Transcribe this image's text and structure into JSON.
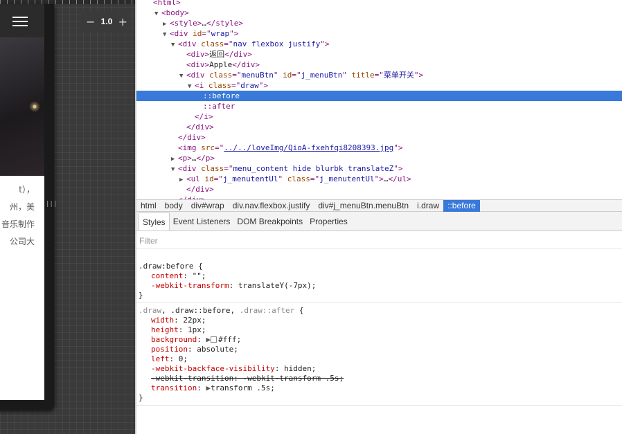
{
  "emulator": {
    "zoom_minus": "−",
    "zoom_value": "1.0",
    "zoom_plus": "+",
    "resize_handle": "|||",
    "app_text_lines": [
      "t），",
      "州，美",
      "音乐制作",
      "公司大"
    ]
  },
  "dom_tree": [
    {
      "indent": 0,
      "tri": "",
      "html": "<span class=\"tag\">&lt;html&gt;</span>",
      "selected": false
    },
    {
      "indent": 1,
      "tri": "▼",
      "html": "<span class=\"tag\">&lt;body&gt;</span>",
      "selected": false
    },
    {
      "indent": 2,
      "tri": "▶",
      "html": "<span class=\"tag\">&lt;style&gt;</span>…<span class=\"tag\">&lt;/style&gt;</span>",
      "selected": false
    },
    {
      "indent": 2,
      "tri": "▼",
      "html": "<span class=\"tag\">&lt;div </span><span class=\"attr\">id</span><span class=\"tag\">=\"</span><span class=\"val\">wrap</span><span class=\"tag\">\"&gt;</span>",
      "selected": false
    },
    {
      "indent": 3,
      "tri": "▼",
      "html": "<span class=\"tag\">&lt;div </span><span class=\"attr\">class</span><span class=\"tag\">=\"</span><span class=\"val\">nav flexbox justify</span><span class=\"tag\">\"&gt;</span>",
      "selected": false
    },
    {
      "indent": 4,
      "tri": "",
      "html": "<span class=\"tag\">&lt;div&gt;</span>返回<span class=\"tag\">&lt;/div&gt;</span>",
      "selected": false
    },
    {
      "indent": 4,
      "tri": "",
      "html": "<span class=\"tag\">&lt;div&gt;</span>Apple<span class=\"tag\">&lt;/div&gt;</span>",
      "selected": false
    },
    {
      "indent": 4,
      "tri": "▼",
      "html": "<span class=\"tag\">&lt;div </span><span class=\"attr\">class</span><span class=\"tag\">=\"</span><span class=\"val\">menuBtn</span><span class=\"tag\">\" </span><span class=\"attr\">id</span><span class=\"tag\">=\"</span><span class=\"val\">j_menuBtn</span><span class=\"tag\">\" </span><span class=\"attr\">title</span><span class=\"tag\">=\"</span><span class=\"val\">菜单开关</span><span class=\"tag\">\"&gt;</span>",
      "selected": false
    },
    {
      "indent": 5,
      "tri": "▼",
      "html": "<span class=\"tag\">&lt;i </span><span class=\"attr\">class</span><span class=\"tag\">=\"</span><span class=\"val\">draw</span><span class=\"tag\">\"&gt;</span>",
      "selected": false
    },
    {
      "indent": 6,
      "tri": "",
      "html": "<span class=\"pseudo\">::before</span>",
      "selected": true
    },
    {
      "indent": 6,
      "tri": "",
      "html": "<span class=\"pseudo\">::after</span>",
      "selected": false
    },
    {
      "indent": 5,
      "tri": "",
      "html": "<span class=\"tag\">&lt;/i&gt;</span>",
      "selected": false
    },
    {
      "indent": 4,
      "tri": "",
      "html": "<span class=\"tag\">&lt;/div&gt;</span>",
      "selected": false
    },
    {
      "indent": 3,
      "tri": "",
      "html": "<span class=\"tag\">&lt;/div&gt;</span>",
      "selected": false
    },
    {
      "indent": 3,
      "tri": "",
      "html": "<span class=\"tag\">&lt;img </span><span class=\"attr\">src</span><span class=\"tag\">=\"</span><span class=\"link\">../../loveImg/QioA-fxehfqi8208393.jpg</span><span class=\"tag\">\"&gt;</span>",
      "selected": false
    },
    {
      "indent": 3,
      "tri": "▶",
      "html": "<span class=\"tag\">&lt;p&gt;</span>…<span class=\"tag\">&lt;/p&gt;</span>",
      "selected": false
    },
    {
      "indent": 3,
      "tri": "▼",
      "html": "<span class=\"tag\">&lt;div </span><span class=\"attr\">class</span><span class=\"tag\">=\"</span><span class=\"val\">menu_content hide blurbk translateZ</span><span class=\"tag\">\"&gt;</span>",
      "selected": false
    },
    {
      "indent": 4,
      "tri": "▶",
      "html": "<span class=\"tag\">&lt;ul </span><span class=\"attr\">id</span><span class=\"tag\">=\"</span><span class=\"val\">j_menutentUl</span><span class=\"tag\">\" </span><span class=\"attr\">class</span><span class=\"tag\">=\"</span><span class=\"val\">j_menutentUl</span><span class=\"tag\">\"&gt;</span>…<span class=\"tag\">&lt;/ul&gt;</span>",
      "selected": false
    },
    {
      "indent": 4,
      "tri": "",
      "html": "<span class=\"tag\">&lt;/div&gt;</span>",
      "selected": false
    },
    {
      "indent": 3,
      "tri": "",
      "html": "<span class=\"tag\">&lt;/div&gt;</span>",
      "selected": false
    }
  ],
  "breadcrumbs": [
    "html",
    "body",
    "div#wrap",
    "div.nav.flexbox.justify",
    "div#j_menuBtn.menuBtn",
    "i.draw",
    "::before"
  ],
  "breadcrumb_active": 6,
  "tabs": [
    "Styles",
    "Event Listeners",
    "DOM Breakpoints",
    "Properties"
  ],
  "tab_active": 0,
  "filter": {
    "placeholder": "Filter"
  },
  "rules": [
    {
      "selector_html": "<span class=\"sel\">.draw:before {</span>",
      "lines": [
        "<span class=\"prop\">content</span>: <span class=\"pval\">\"\";</span>",
        "<span class=\"prop\">-webkit-transform</span>: <span class=\"pval\">translateY(-7px);</span>"
      ]
    },
    {
      "selector_html": "<span class=\"sel-dim\">.draw</span><span class=\"sel\">, .draw::before, </span><span class=\"sel-dim\">.draw::after</span><span class=\"sel\"> {</span>",
      "lines": [
        "<span class=\"prop\">width</span>: <span class=\"pval\">22px;</span>",
        "<span class=\"prop\">height</span>: <span class=\"pval\">1px;</span>",
        "<span class=\"prop\">background</span>: <span class=\"tri\">▶</span><span class=\"swatch\"></span><span class=\"pval\">#fff;</span>",
        "<span class=\"prop\">position</span>: <span class=\"pval\">absolute;</span>",
        "<span class=\"prop\">left</span>: <span class=\"pval\">0;</span>",
        "<span class=\"prop\">-webkit-backface-visibility</span>: <span class=\"pval\">hidden;</span>",
        "<span class=\"strike\">-webkit-transition: -webkit-transform .5s;</span>",
        "<span class=\"prop\">transition</span>: <span class=\"tri\">▶</span><span class=\"pval\">transform .5s;</span>"
      ]
    }
  ]
}
